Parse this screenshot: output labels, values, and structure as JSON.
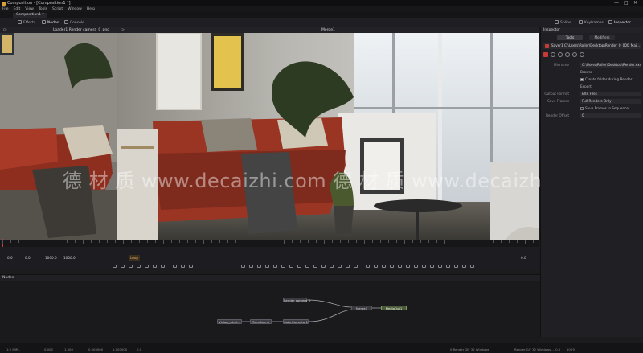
{
  "window": {
    "title": "Composition - [Composition1 *]",
    "controls": [
      "—",
      "□",
      "✕"
    ]
  },
  "menu": [
    "File",
    "Edit",
    "View",
    "Tools",
    "Script",
    "Window",
    "Help"
  ],
  "composition_tab": "Composition1 *",
  "toolbar": {
    "left": [
      {
        "label": "Effects",
        "icon": "effects-icon"
      },
      {
        "label": "Nodes",
        "icon": "nodes-icon"
      },
      {
        "label": "Console",
        "icon": "console-icon"
      }
    ],
    "right": [
      {
        "label": "Spline",
        "icon": "spline-icon"
      },
      {
        "label": "Keyframes",
        "icon": "keyframes-icon"
      },
      {
        "label": "Inspector",
        "icon": "inspector-icon"
      }
    ]
  },
  "viewer": {
    "header_left": "Loader1 Render camera_0_png",
    "header_center": "Merge1",
    "zoom_left": "Fit",
    "zoom_right": "Fit"
  },
  "watermark": "德 材 质 www.decaizhi.com 德 材 质 www.decaizhi.site",
  "transport": {
    "start": "0.0",
    "current": "0.0",
    "render_start": "1000.0",
    "render_end": "1000.0",
    "loop_label": "Loop",
    "end_frame": "0.0"
  },
  "timeline": {
    "playhead_frame": 0,
    "range": [
      0,
      1000
    ]
  },
  "inspector": {
    "title": "Inspector",
    "tabs": [
      "Tools",
      "Modifiers"
    ],
    "node_name": "Saver1 C:\\Users\\Roller\\Desktop\\Render_0_000_Mai...",
    "params": [
      {
        "label": "Filename",
        "value": "C:\\Users\\Roller\\Desktop\\Render.exr"
      },
      {
        "label": "",
        "value": "Browse",
        "plain": true
      },
      {
        "label": "",
        "value": "Create folder during Render",
        "check": true,
        "on": true
      },
      {
        "label": "",
        "value": "Export",
        "plain": true
      },
      {
        "label": "Output Format",
        "value": "EXR Files"
      },
      {
        "label": "Save Frames",
        "value": "Full Renders Only"
      },
      {
        "label": "",
        "value": "Save Frames in Sequence",
        "check": true,
        "on": false
      },
      {
        "label": "Render Offset",
        "value": "0"
      }
    ]
  },
  "nodes_panel": {
    "title": "Nodes",
    "nodes": [
      {
        "id": "n1",
        "label": "Render camera_0"
      },
      {
        "id": "n2",
        "label": "Merge1"
      },
      {
        "id": "n3",
        "label": "MediaOut1"
      },
      {
        "id": "n4",
        "label": "Vision_rebel..."
      },
      {
        "id": "n5",
        "label": "Transform1"
      },
      {
        "id": "n6",
        "label": "ColorCorrector1"
      }
    ]
  },
  "status": {
    "items": [
      "1:2 MIP...",
      "0.000",
      "1.000",
      "0.000000",
      "1.000000",
      "0.0",
      "0 Render GIF 32 Windows",
      "Render GIF 32 Windows ... 0.0",
      "100%"
    ]
  }
}
